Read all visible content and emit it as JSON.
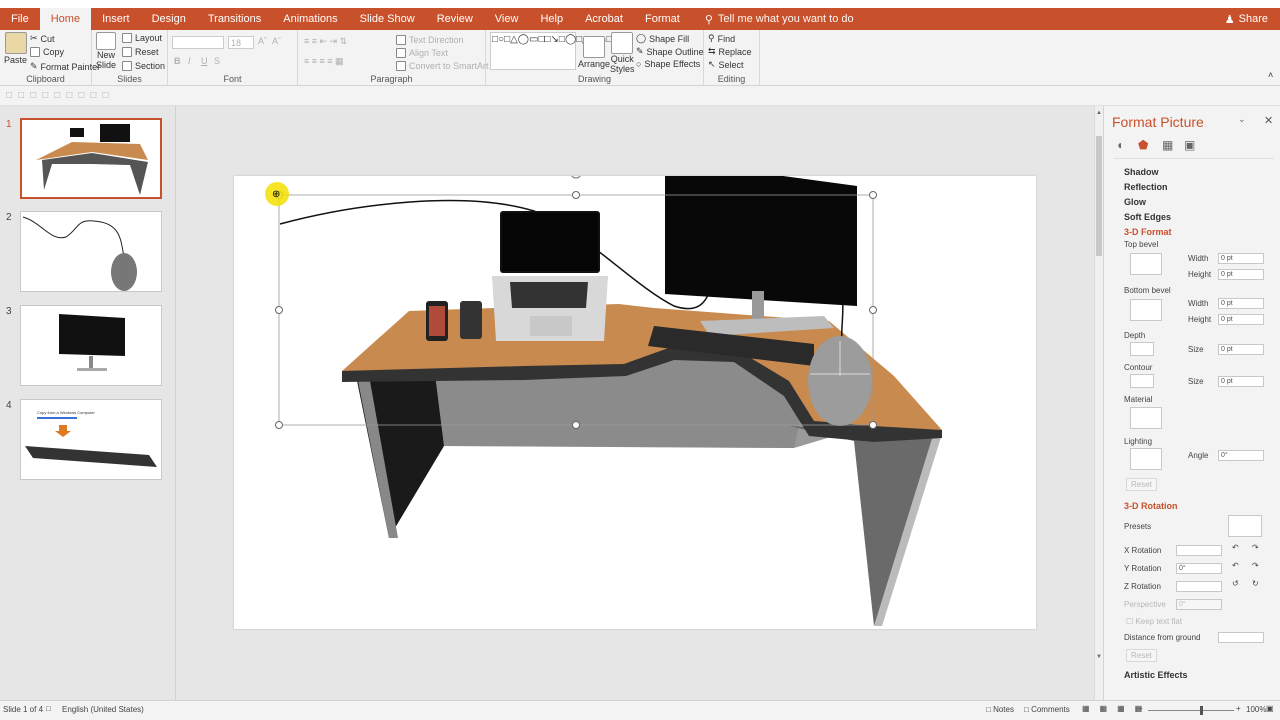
{
  "tabs": [
    "File",
    "Home",
    "Insert",
    "Design",
    "Transitions",
    "Animations",
    "Slide Show",
    "Review",
    "View",
    "Help",
    "Acrobat",
    "Format"
  ],
  "active_tab": "Home",
  "tell_me": "Tell me what you want to do",
  "share": "Share",
  "ribbon": {
    "clipboard": {
      "paste": "Paste",
      "cut": "Cut",
      "copy": "Copy",
      "format_painter": "Format Painter",
      "label": "Clipboard"
    },
    "slides": {
      "new_slide_1": "New",
      "new_slide_2": "Slide",
      "layout": "Layout",
      "reset": "Reset",
      "section": "Section",
      "label": "Slides"
    },
    "font": {
      "size": "18",
      "label": "Font",
      "bold": "B",
      "italic": "I",
      "underline": "U",
      "strike": "S"
    },
    "paragraph": {
      "text_direction": "Text Direction",
      "align_text": "Align Text",
      "convert_smartart": "Convert to SmartArt",
      "label": "Paragraph"
    },
    "drawing": {
      "arrange": "Arrange",
      "quick_styles_1": "Quick",
      "quick_styles_2": "Styles",
      "shape_fill": "Shape Fill",
      "shape_outline": "Shape Outline",
      "shape_effects": "Shape Effects",
      "label": "Drawing"
    },
    "editing": {
      "find": "Find",
      "replace": "Replace",
      "select": "Select",
      "label": "Editing"
    }
  },
  "slides": [
    "1",
    "2",
    "3",
    "4"
  ],
  "thumb4_text": "Copy from a Windows Computer",
  "format_pane": {
    "title": "Format Picture",
    "sections": {
      "shadow": "Shadow",
      "reflection": "Reflection",
      "glow": "Glow",
      "soft_edges": "Soft Edges",
      "format3d": "3-D Format",
      "rotation3d": "3-D Rotation",
      "artistic": "Artistic Effects"
    },
    "top_bevel": "Top bevel",
    "bottom_bevel": "Bottom bevel",
    "width": "Width",
    "height": "Height",
    "depth": "Depth",
    "contour": "Contour",
    "size": "Size",
    "material": "Material",
    "lighting": "Lighting",
    "angle": "Angle",
    "reset": "Reset",
    "presets": "Presets",
    "x_rotation": "X Rotation",
    "y_rotation": "Y Rotation",
    "z_rotation": "Z Rotation",
    "perspective": "Perspective",
    "keep_text_flat": "Keep text flat",
    "distance": "Distance from ground",
    "values": {
      "pt0": "0 pt",
      "deg0": "0°"
    }
  },
  "status": {
    "slide": "Slide 1 of 4",
    "language": "English (United States)",
    "notes": "Notes",
    "comments": "Comments",
    "zoom": "100%"
  },
  "colors": {
    "accent": "#c8502b",
    "desk_top": "#c88a4e"
  }
}
